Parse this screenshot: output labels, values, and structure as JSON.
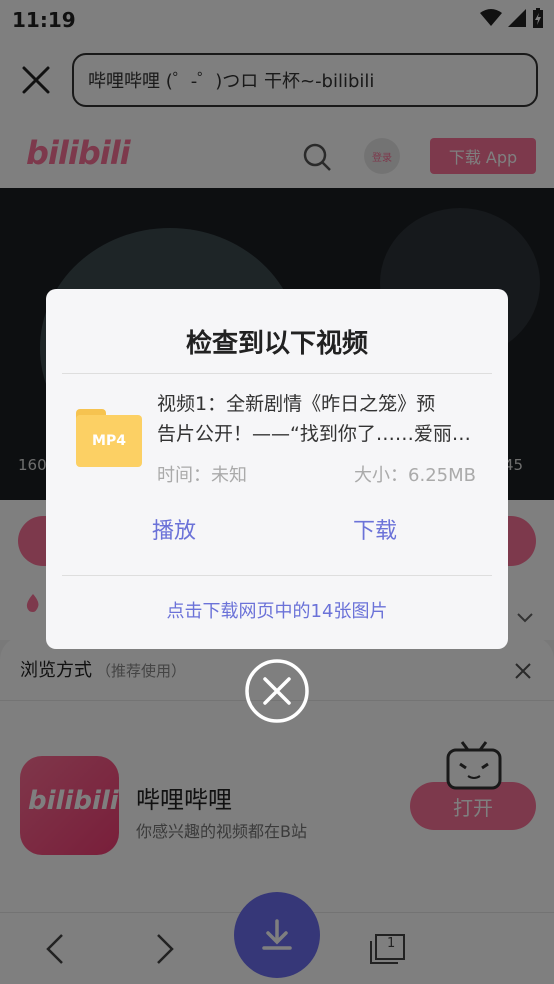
{
  "status_bar": {
    "time": "11:19"
  },
  "browser": {
    "url_text": "哔哩哔哩 (゜-゜)つロ 干杯~-bilibili"
  },
  "site": {
    "logo": "bilibili",
    "login": "登录",
    "download_app": "下载 App"
  },
  "video_overlay": {
    "left_text": "160",
    "right_text": "45"
  },
  "dialog": {
    "title": "检查到以下视频",
    "file_badge": "MP4",
    "video_title_line1": "视频1：全新剧情《昨日之笼》预",
    "video_title_line2": "告片公开！——“找到你了……爱丽…",
    "time_text": "时间：未知",
    "size_text": "大小：6.25MB",
    "play_label": "播放",
    "download_label": "下载",
    "images_link": "点击下载网页中的14张图片"
  },
  "sheet": {
    "title": "浏览方式",
    "subtitle": "（推荐使用）",
    "app_name": "哔哩哔哩",
    "app_desc": "你感兴趣的视频都在B站",
    "open_label": "打开"
  },
  "nav": {
    "tab_count": "1"
  },
  "colors": {
    "accent": "#6b72d8",
    "brand_pink": "#fb7299",
    "fab": "#6d6ff0",
    "folder": "#fcd064"
  }
}
